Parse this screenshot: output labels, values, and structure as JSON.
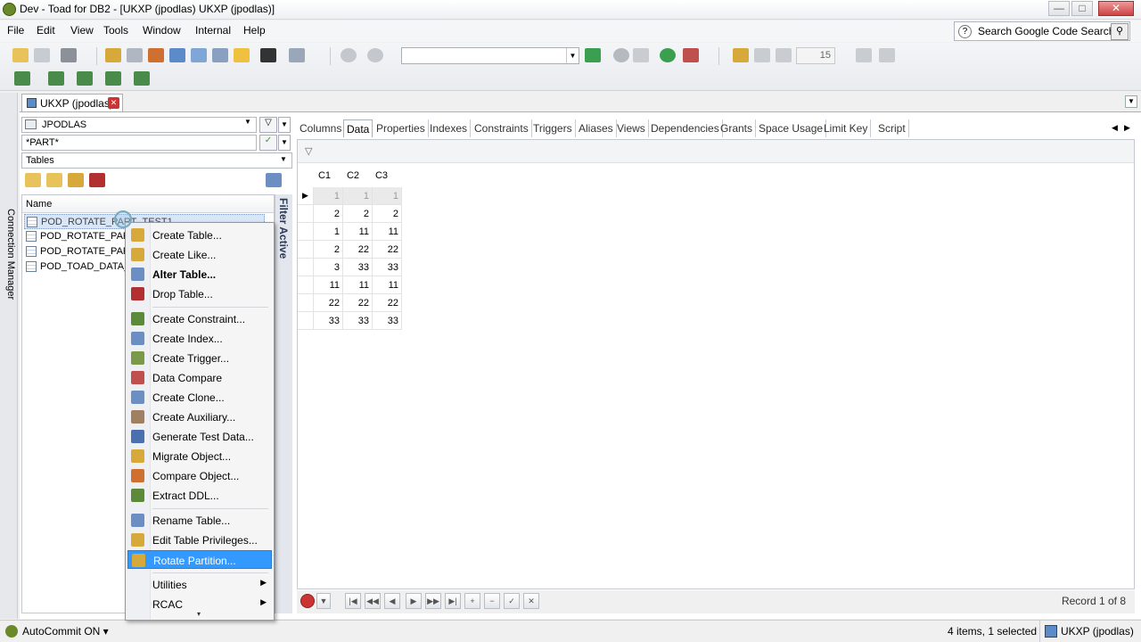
{
  "window": {
    "title": "Dev - Toad for DB2 - [UKXP (jpodlas) UKXP (jpodlas)]",
    "min": "—",
    "max": "□",
    "close": "✕"
  },
  "menu": [
    "File",
    "Edit",
    "View",
    "Tools",
    "Window",
    "Internal",
    "Help"
  ],
  "search": {
    "placeholder": "Search Google Code Search"
  },
  "toolbar": {
    "page_size": "15"
  },
  "sidebar": {
    "label": "Connection Manager"
  },
  "doc_tab": {
    "label": "UKXP (jpodlas)",
    "close": "✕"
  },
  "object_pane": {
    "schema": "JPODLAS",
    "filter": "*PART*",
    "object_type": "Tables",
    "list_header": "Name",
    "rows": [
      "POD_ROTATE_PART_TEST1",
      "POD_ROTATE_PART_TEST2",
      "POD_ROTATE_PART_TEST3",
      "POD_TOAD_DATA_TEST"
    ],
    "filter_label": "Filter Active"
  },
  "detail_tabs": [
    "Columns",
    "Data",
    "Properties",
    "Indexes",
    "Constraints",
    "Triggers",
    "Aliases",
    "Views",
    "Dependencies",
    "Grants",
    "Space Usage",
    "Limit Key",
    "Script"
  ],
  "active_tab": "Data",
  "grid": {
    "columns": [
      "C1",
      "C2",
      "C3"
    ],
    "rows": [
      [
        "1",
        "1",
        "1"
      ],
      [
        "2",
        "2",
        "2"
      ],
      [
        "1",
        "11",
        "11"
      ],
      [
        "2",
        "22",
        "22"
      ],
      [
        "3",
        "33",
        "33"
      ],
      [
        "11",
        "11",
        "11"
      ],
      [
        "22",
        "22",
        "22"
      ],
      [
        "33",
        "33",
        "33"
      ]
    ]
  },
  "record_info": "Record 1 of 8",
  "context_menu": {
    "items": [
      {
        "label": "Create Table...",
        "icon": "create-table-icon",
        "color": "#d6a93a"
      },
      {
        "label": "Create Like...",
        "icon": "create-like-icon",
        "color": "#d6a93a"
      },
      {
        "label": "Alter Table...",
        "icon": "alter-table-icon",
        "color": "#6b8fc2",
        "bold": true
      },
      {
        "label": "Drop Table...",
        "icon": "drop-table-icon",
        "color": "#b23030"
      },
      {
        "sep": true
      },
      {
        "label": "Create Constraint...",
        "icon": "constraint-icon",
        "color": "#5a8a3a"
      },
      {
        "label": "Create Index...",
        "icon": "index-icon",
        "color": "#6b8fc2"
      },
      {
        "label": "Create Trigger...",
        "icon": "trigger-icon",
        "color": "#7a9a4a"
      },
      {
        "label": "Data Compare",
        "icon": "data-compare-icon",
        "color": "#c0504d"
      },
      {
        "label": "Create Clone...",
        "icon": "clone-icon",
        "color": "#6b8fc2"
      },
      {
        "label": "Create Auxiliary...",
        "icon": "auxiliary-icon",
        "color": "#a08060"
      },
      {
        "label": "Generate Test Data...",
        "icon": "test-data-icon",
        "color": "#4a70b0"
      },
      {
        "label": "Migrate Object...",
        "icon": "migrate-icon",
        "color": "#d6a93a"
      },
      {
        "label": "Compare Object...",
        "icon": "compare-icon",
        "color": "#d07030"
      },
      {
        "label": "Extract DDL...",
        "icon": "extract-ddl-icon",
        "color": "#5a8a3a"
      },
      {
        "sep": true
      },
      {
        "label": "Rename Table...",
        "icon": "rename-icon",
        "color": "#6b8fc2"
      },
      {
        "label": "Edit Table Privileges...",
        "icon": "privileges-icon",
        "color": "#d6a93a"
      },
      {
        "label": "Rotate Partition...",
        "icon": "rotate-partition-icon",
        "color": "#d6a93a",
        "highlighted": true
      },
      {
        "sep": true
      },
      {
        "label": "Utilities",
        "submenu": true
      },
      {
        "label": "RCAC",
        "submenu": true
      }
    ],
    "more": "▾"
  },
  "status": {
    "autocommit": "AutoCommit ON ▾",
    "selection": "4 items, 1 selected",
    "connection": "UKXP (jpodlas)"
  }
}
